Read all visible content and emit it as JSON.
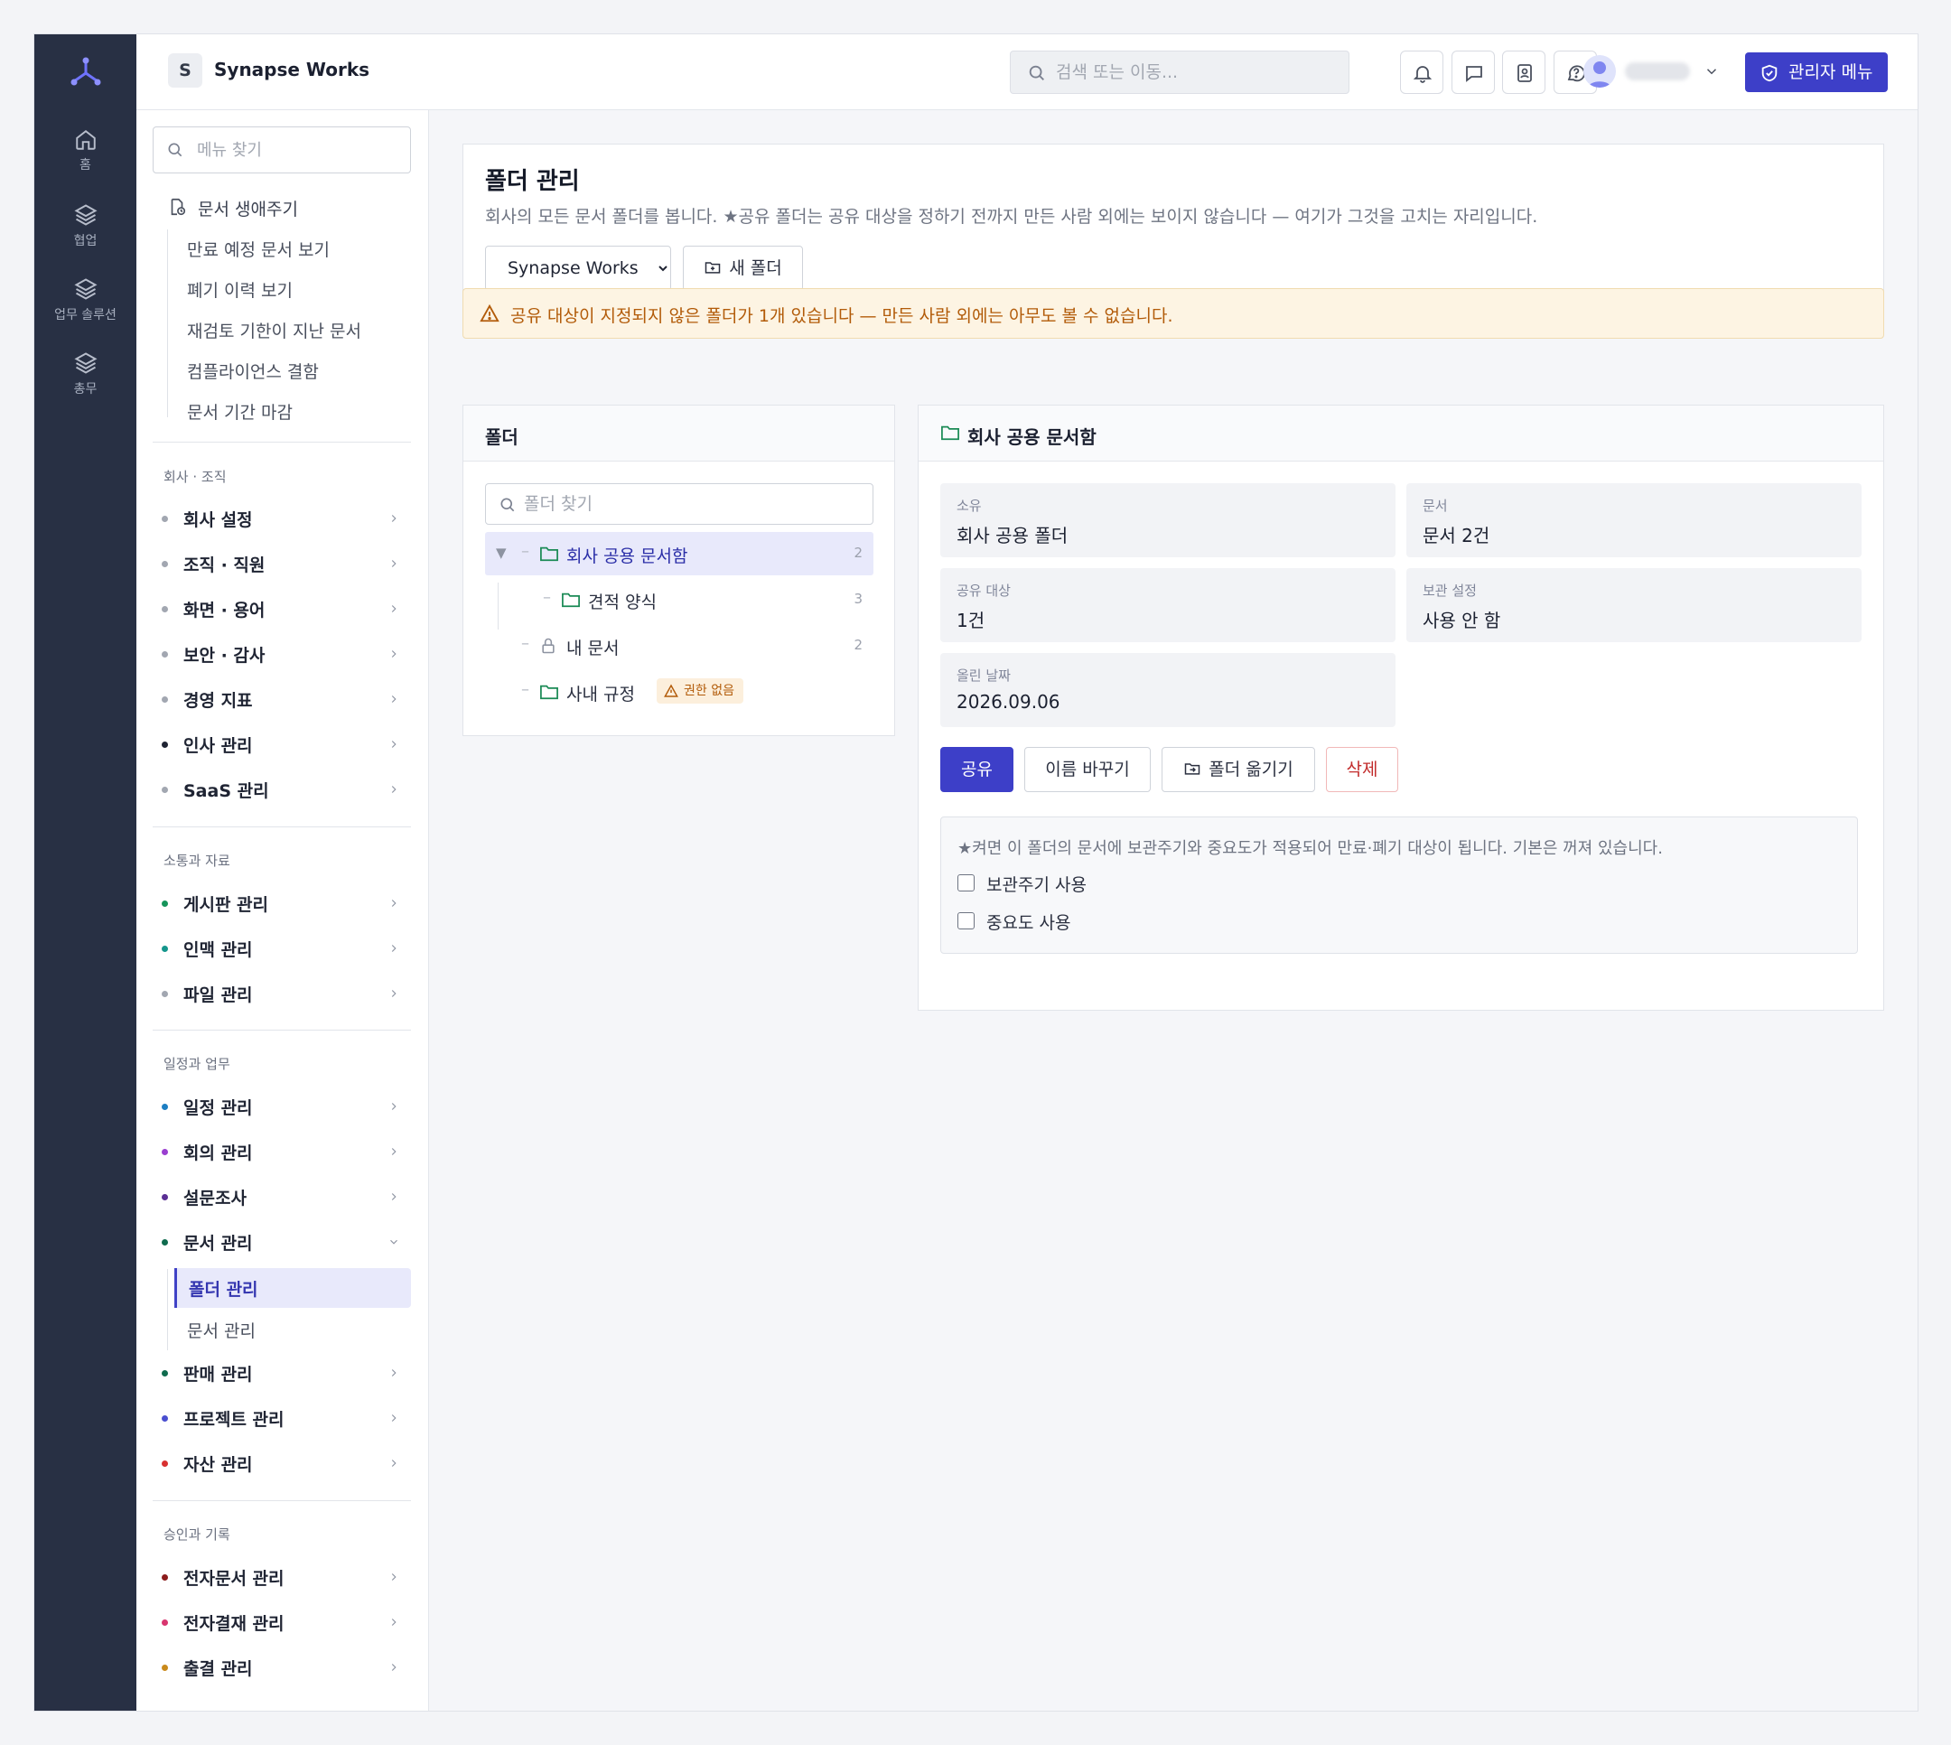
{
  "workspace": {
    "initial": "S",
    "name": "Synapse Works"
  },
  "top_search": {
    "placeholder": "검색 또는 이동..."
  },
  "admin_button": {
    "label": "관리자 메뉴"
  },
  "rail": {
    "items": [
      {
        "label": "홈",
        "icon": "home-icon"
      },
      {
        "label": "협업",
        "icon": "layers-icon"
      },
      {
        "label": "업무 솔루션",
        "icon": "layers-icon"
      },
      {
        "label": "총무",
        "icon": "layers-icon"
      }
    ]
  },
  "sidebar": {
    "menu_search_placeholder": "메뉴 찾기",
    "lifecycle": {
      "title": "문서 생애주기",
      "items": [
        "만료 예정 문서 보기",
        "폐기 이력 보기",
        "재검토 기한이 지난 문서",
        "컴플라이언스 결함",
        "문서 기간 마감"
      ]
    },
    "sections": [
      {
        "title": "회사 · 조직",
        "items": [
          {
            "label": "회사 설정",
            "dot": "#a2a7b1"
          },
          {
            "label": "조직 · 직원",
            "dot": "#a2a7b1"
          },
          {
            "label": "화면 · 용어",
            "dot": "#a2a7b1"
          },
          {
            "label": "보안 · 감사",
            "dot": "#a2a7b1"
          },
          {
            "label": "경영 지표",
            "dot": "#a2a7b1"
          },
          {
            "label": "인사 관리",
            "dot": "#1f2433"
          },
          {
            "label": "SaaS 관리",
            "dot": "#a2a7b1"
          }
        ]
      },
      {
        "title": "소통과 자료",
        "items": [
          {
            "label": "게시판 관리",
            "dot": "#15945a"
          },
          {
            "label": "인맥 관리",
            "dot": "#15968c"
          },
          {
            "label": "파일 관리",
            "dot": "#a2a7b1"
          }
        ]
      },
      {
        "title": "일정과 업무",
        "items": [
          {
            "label": "일정 관리",
            "dot": "#1d7ec2"
          },
          {
            "label": "회의 관리",
            "dot": "#9a3fd0"
          },
          {
            "label": "설문조사",
            "dot": "#5b2f94"
          },
          {
            "label": "문서 관리",
            "dot": "#0f6b4e"
          },
          {
            "label": "판매 관리",
            "dot": "#0f6b4e"
          },
          {
            "label": "프로젝트 관리",
            "dot": "#4a4fd0"
          },
          {
            "label": "자산 관리",
            "dot": "#d83030"
          }
        ]
      },
      {
        "title": "승인과 기록",
        "items": [
          {
            "label": "전자문서 관리",
            "dot": "#8c1c1c"
          },
          {
            "label": "전자결재 관리",
            "dot": "#d8356f"
          },
          {
            "label": "출결 관리",
            "dot": "#c98a1b"
          }
        ]
      }
    ],
    "doc_sub": [
      "폴더 관리",
      "문서 관리"
    ]
  },
  "page": {
    "title": "폴더 관리",
    "description": "회사의 모든 문서 폴더를 봅니다. ★공유 폴더는 공유 대상을 정하기 전까지 만든 사람 외에는 보이지 않습니다 — 여기가 그것을 고치는 자리입니다.",
    "workspace_select": "Synapse Works",
    "new_folder": "새 폴더"
  },
  "alert": "공유 대상이 지정되지 않은 폴더가 1개 있습니다 — 만든 사람 외에는 아무도 볼 수 없습니다.",
  "folder_panel": {
    "title": "폴더",
    "search_placeholder": "폴더 찾기",
    "tree": [
      {
        "name": "회사 공용 문서함",
        "count": "2",
        "toggle": "▼",
        "icon": "folder-icon",
        "selected": true
      },
      {
        "name": "견적 양식",
        "count": "3",
        "icon": "folder-icon"
      },
      {
        "name": "내 문서",
        "count": "2",
        "icon": "lock-icon"
      },
      {
        "name": "사내 규정",
        "count": "",
        "icon": "folder-icon",
        "badge": "권한 없음"
      }
    ]
  },
  "detail": {
    "title": "회사 공용 문서함",
    "fields": [
      {
        "key": "소유",
        "value": "회사 공용 폴더"
      },
      {
        "key": "문서",
        "value": "문서 2건"
      },
      {
        "key": "공유 대상",
        "value": "1건"
      },
      {
        "key": "보관 설정",
        "value": "사용 안 함"
      },
      {
        "key": "올린 날짜",
        "value": "2026.09.06"
      }
    ],
    "actions": {
      "share": "공유",
      "rename": "이름 바꾸기",
      "move": "폴더 옮기기",
      "delete": "삭제"
    },
    "retention_note": "★켜면 이 폴더의 문서에 보관주기와 중요도가 적용되어 만료·폐기 대상이 됩니다. 기본은 꺼져 있습니다.",
    "checkboxes": [
      {
        "label": "보관주기 사용",
        "checked": false
      },
      {
        "label": "중요도 사용",
        "checked": false
      }
    ]
  }
}
